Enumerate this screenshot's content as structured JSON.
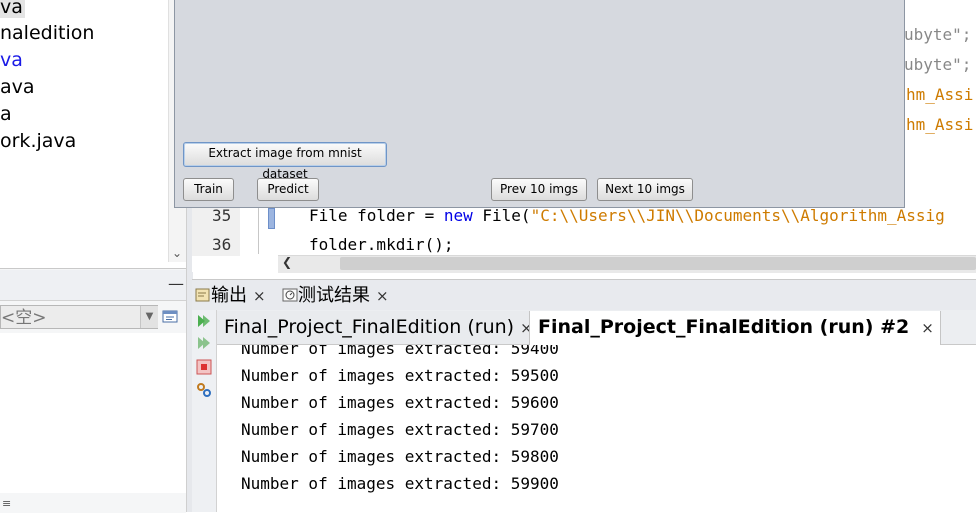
{
  "tree": {
    "items": [
      {
        "label": "va",
        "color": "#000000",
        "highlight": true
      },
      {
        "label": "naledition",
        "color": "#000000"
      },
      {
        "label": "va",
        "color": "#1a1ae6"
      },
      {
        "label": "ava",
        "color": "#000000"
      },
      {
        "label": "a",
        "color": "#000000"
      },
      {
        "label": "ork.java",
        "color": "#000000"
      }
    ]
  },
  "navigator": {
    "minimize_label": "—",
    "combo_value": "<空>"
  },
  "editor": {
    "top_lines": [
      {
        "text": "ubyte\";",
        "kind": "gray"
      },
      {
        "text": "ubyte\";",
        "kind": "gray"
      },
      {
        "text": "hm_Assi",
        "kind": "str"
      },
      {
        "text": "hm_Assi",
        "kind": "str"
      }
    ],
    "lines": [
      {
        "number": "35",
        "code_prefix": "File folder = ",
        "keyword": "new",
        "code_mid": " File(",
        "string": "\"C:\\\\Users\\\\JIN\\\\Documents\\\\Algorithm_Assig"
      },
      {
        "number": "36",
        "code": "folder.mkdir();"
      }
    ]
  },
  "dialog": {
    "extract_button": "Extract image from mnist dataset",
    "train_button": "Train",
    "predict_button": "Predict",
    "prev_button": "Prev 10 imgs",
    "next_button": "Next 10 imgs"
  },
  "output": {
    "tabs": [
      {
        "label": "输出",
        "icon": "output-window-icon"
      },
      {
        "label": "测试结果",
        "icon": "test-results-icon"
      }
    ],
    "run_tabs": [
      {
        "label": "Final_Project_FinalEdition (run)"
      },
      {
        "label": "Final_Project_FinalEdition (run) #2"
      }
    ],
    "close_glyph": "×",
    "lines": [
      "Number of images extracted: 59400",
      "Number of images extracted: 59500",
      "Number of images extracted: 59600",
      "Number of images extracted: 59700",
      "Number of images extracted: 59800",
      "Number of images extracted: 59900"
    ]
  }
}
